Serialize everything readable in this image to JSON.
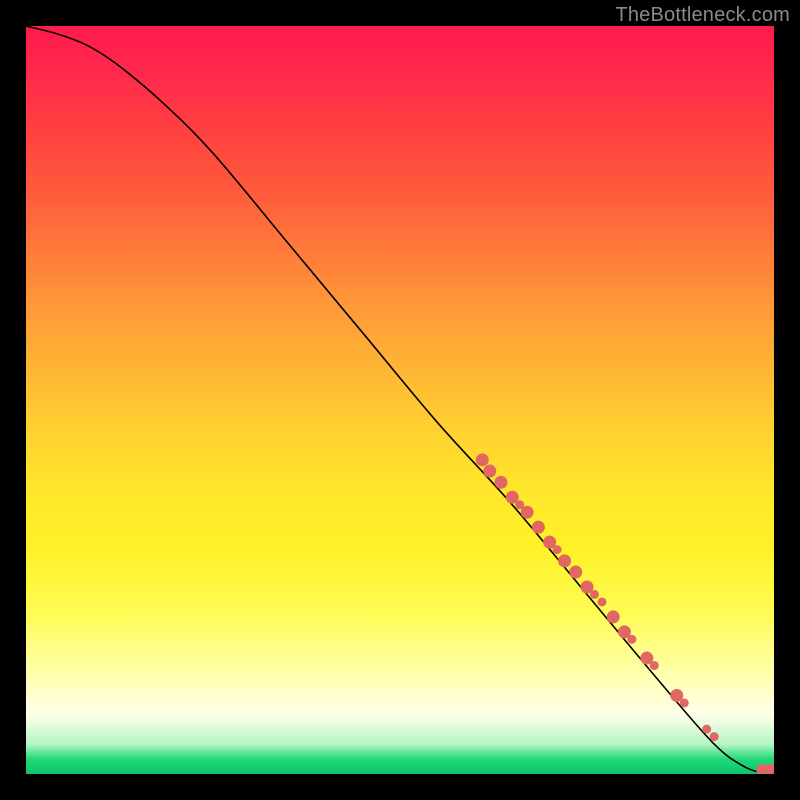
{
  "watermark": "TheBottleneck.com",
  "chart_data": {
    "type": "line",
    "title": "",
    "xlabel": "",
    "ylabel": "",
    "xlim": [
      0,
      100
    ],
    "ylim": [
      0,
      100
    ],
    "curve": {
      "x": [
        0,
        4,
        8,
        12,
        18,
        25,
        35,
        45,
        55,
        65,
        75,
        85,
        92,
        96,
        99,
        100
      ],
      "y": [
        100,
        99,
        97.5,
        95,
        90,
        83,
        71,
        59,
        47,
        36,
        24,
        12,
        4,
        1,
        0,
        0
      ]
    },
    "points": {
      "color": "#e06762",
      "radius_small": 4.5,
      "radius_large": 6.5,
      "data": [
        {
          "x": 61,
          "y": 42,
          "r": "large"
        },
        {
          "x": 62,
          "y": 40.5,
          "r": "large"
        },
        {
          "x": 63.5,
          "y": 39,
          "r": "large"
        },
        {
          "x": 65,
          "y": 37,
          "r": "large"
        },
        {
          "x": 66,
          "y": 36,
          "r": "small"
        },
        {
          "x": 67,
          "y": 35,
          "r": "large"
        },
        {
          "x": 68.5,
          "y": 33,
          "r": "large"
        },
        {
          "x": 70,
          "y": 31,
          "r": "large"
        },
        {
          "x": 71,
          "y": 30,
          "r": "small"
        },
        {
          "x": 72,
          "y": 28.5,
          "r": "large"
        },
        {
          "x": 73.5,
          "y": 27,
          "r": "large"
        },
        {
          "x": 75,
          "y": 25,
          "r": "large"
        },
        {
          "x": 76,
          "y": 24,
          "r": "small"
        },
        {
          "x": 77,
          "y": 23,
          "r": "small"
        },
        {
          "x": 78.5,
          "y": 21,
          "r": "large"
        },
        {
          "x": 80,
          "y": 19,
          "r": "large"
        },
        {
          "x": 81,
          "y": 18,
          "r": "small"
        },
        {
          "x": 83,
          "y": 15.5,
          "r": "large"
        },
        {
          "x": 84,
          "y": 14.5,
          "r": "small"
        },
        {
          "x": 87,
          "y": 10.5,
          "r": "large"
        },
        {
          "x": 88,
          "y": 9.5,
          "r": "small"
        },
        {
          "x": 91,
          "y": 6,
          "r": "small"
        },
        {
          "x": 92,
          "y": 5,
          "r": "small"
        },
        {
          "x": 98.5,
          "y": 0.5,
          "r": "large"
        },
        {
          "x": 99.5,
          "y": 0.5,
          "r": "large"
        }
      ]
    }
  }
}
